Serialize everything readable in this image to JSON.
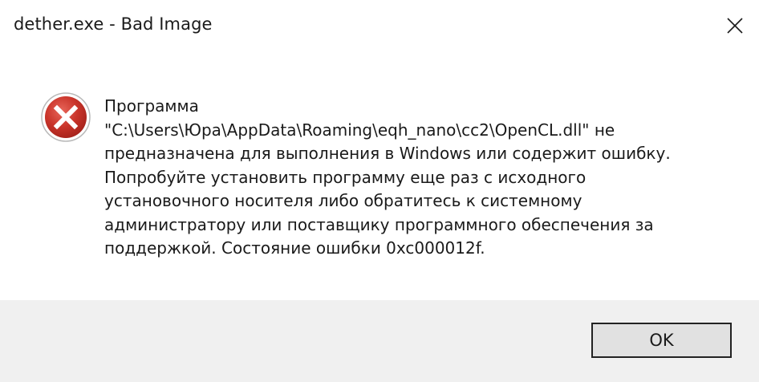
{
  "window": {
    "title": "dether.exe - Bad Image"
  },
  "icons": {
    "error": "error-x-circle",
    "close": "close-x",
    "error_color": "#c42b1c"
  },
  "message": {
    "lines": [
      "Программа",
      "\"C:\\Users\\Юра\\AppData\\Roaming\\eqh_nano\\cc2\\OpenCL.dll\" не",
      "предназначена для выполнения в Windows или содержит ошибку.",
      "Попробуйте установить программу еще раз с исходного",
      "установочного носителя либо обратитесь к системному",
      "администратору или поставщику программного обеспечения за",
      "поддержкой. Состояние ошибки 0xc000012f."
    ]
  },
  "buttons": {
    "ok_label": "OK"
  }
}
